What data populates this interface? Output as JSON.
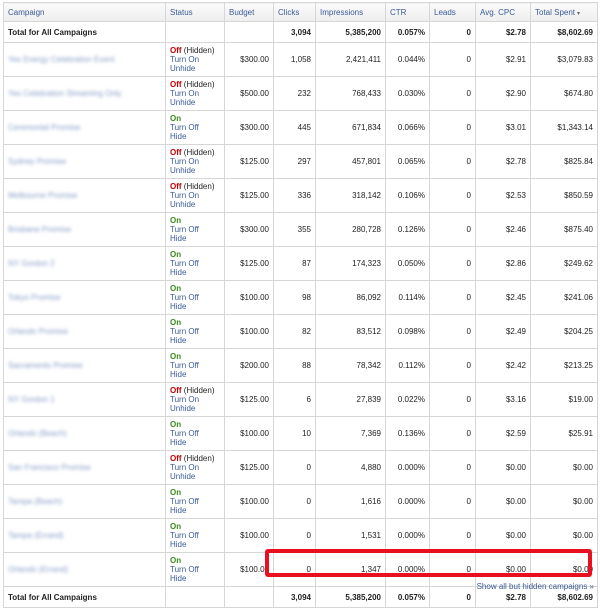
{
  "columns": [
    "Campaign",
    "Status",
    "Budget",
    "Clicks",
    "Impressions",
    "CTR",
    "Leads",
    "Avg. CPC",
    "Total Spent"
  ],
  "sort_indicator": "▾",
  "total": {
    "label": "Total for All Campaigns",
    "clicks": "3,094",
    "impressions": "5,385,200",
    "ctr": "0.057%",
    "leads": "0",
    "avg_cpc": "$2.78",
    "total_spent": "$8,602.69"
  },
  "rows": [
    {
      "name": "Yes Energy Celebration Event",
      "status": "Off",
      "hidden": "(Hidden)",
      "a1": "Turn On",
      "a2": "Unhide",
      "budget": "$300.00",
      "clicks": "1,058",
      "impressions": "2,421,411",
      "ctr": "0.044%",
      "leads": "0",
      "cpc": "$2.91",
      "spent": "$3,079.83"
    },
    {
      "name": "Yes Celebration Streaming Only",
      "status": "Off",
      "hidden": "(Hidden)",
      "a1": "Turn On",
      "a2": "Unhide",
      "budget": "$500.00",
      "clicks": "232",
      "impressions": "768,433",
      "ctr": "0.030%",
      "leads": "0",
      "cpc": "$2.90",
      "spent": "$674.80"
    },
    {
      "name": "Ceremonial Promise",
      "status": "On",
      "hidden": "",
      "a1": "Turn Off",
      "a2": "Hide",
      "budget": "$300.00",
      "clicks": "445",
      "impressions": "671,834",
      "ctr": "0.066%",
      "leads": "0",
      "cpc": "$3.01",
      "spent": "$1,343.14"
    },
    {
      "name": "Sydney Promise",
      "status": "Off",
      "hidden": "(Hidden)",
      "a1": "Turn On",
      "a2": "Unhide",
      "budget": "$125.00",
      "clicks": "297",
      "impressions": "457,801",
      "ctr": "0.065%",
      "leads": "0",
      "cpc": "$2.78",
      "spent": "$825.84"
    },
    {
      "name": "Melbourne Promise",
      "status": "Off",
      "hidden": "(Hidden)",
      "a1": "Turn On",
      "a2": "Unhide",
      "budget": "$125.00",
      "clicks": "336",
      "impressions": "318,142",
      "ctr": "0.106%",
      "leads": "0",
      "cpc": "$2.53",
      "spent": "$850.59"
    },
    {
      "name": "Brisbane Promise",
      "status": "On",
      "hidden": "",
      "a1": "Turn Off",
      "a2": "Hide",
      "budget": "$300.00",
      "clicks": "355",
      "impressions": "280,728",
      "ctr": "0.126%",
      "leads": "0",
      "cpc": "$2.46",
      "spent": "$875.40"
    },
    {
      "name": "NY Gordon 2",
      "status": "On",
      "hidden": "",
      "a1": "Turn Off",
      "a2": "Hide",
      "budget": "$125.00",
      "clicks": "87",
      "impressions": "174,323",
      "ctr": "0.050%",
      "leads": "0",
      "cpc": "$2.86",
      "spent": "$249.62"
    },
    {
      "name": "Tokyo Promise",
      "status": "On",
      "hidden": "",
      "a1": "Turn Off",
      "a2": "Hide",
      "budget": "$100.00",
      "clicks": "98",
      "impressions": "86,092",
      "ctr": "0.114%",
      "leads": "0",
      "cpc": "$2.45",
      "spent": "$241.06"
    },
    {
      "name": "Orlando Promise",
      "status": "On",
      "hidden": "",
      "a1": "Turn Off",
      "a2": "Hide",
      "budget": "$100.00",
      "clicks": "82",
      "impressions": "83,512",
      "ctr": "0.098%",
      "leads": "0",
      "cpc": "$2.49",
      "spent": "$204.25"
    },
    {
      "name": "Sacramento Promise",
      "status": "On",
      "hidden": "",
      "a1": "Turn Off",
      "a2": "Hide",
      "budget": "$200.00",
      "clicks": "88",
      "impressions": "78,342",
      "ctr": "0.112%",
      "leads": "0",
      "cpc": "$2.42",
      "spent": "$213.25"
    },
    {
      "name": "NY Gordon 1",
      "status": "Off",
      "hidden": "(Hidden)",
      "a1": "Turn On",
      "a2": "Unhide",
      "budget": "$125.00",
      "clicks": "6",
      "impressions": "27,839",
      "ctr": "0.022%",
      "leads": "0",
      "cpc": "$3.16",
      "spent": "$19.00"
    },
    {
      "name": "Orlando (Beach)",
      "status": "On",
      "hidden": "",
      "a1": "Turn Off",
      "a2": "Hide",
      "budget": "$100.00",
      "clicks": "10",
      "impressions": "7,369",
      "ctr": "0.136%",
      "leads": "0",
      "cpc": "$2.59",
      "spent": "$25.91"
    },
    {
      "name": "San Francisco Promise",
      "status": "Off",
      "hidden": "(Hidden)",
      "a1": "Turn On",
      "a2": "Unhide",
      "budget": "$125.00",
      "clicks": "0",
      "impressions": "4,880",
      "ctr": "0.000%",
      "leads": "0",
      "cpc": "$0.00",
      "spent": "$0.00"
    },
    {
      "name": "Tampa (Beach)",
      "status": "On",
      "hidden": "",
      "a1": "Turn Off",
      "a2": "Hide",
      "budget": "$100.00",
      "clicks": "0",
      "impressions": "1,616",
      "ctr": "0.000%",
      "leads": "0",
      "cpc": "$0.00",
      "spent": "$0.00"
    },
    {
      "name": "Tampa (Errand)",
      "status": "On",
      "hidden": "",
      "a1": "Turn Off",
      "a2": "Hide",
      "budget": "$100.00",
      "clicks": "0",
      "impressions": "1,531",
      "ctr": "0.000%",
      "leads": "0",
      "cpc": "$0.00",
      "spent": "$0.00"
    },
    {
      "name": "Orlando (Errand)",
      "status": "On",
      "hidden": "",
      "a1": "Turn Off",
      "a2": "Hide",
      "budget": "$100.00",
      "clicks": "0",
      "impressions": "1,347",
      "ctr": "0.000%",
      "leads": "0",
      "cpc": "$0.00",
      "spent": "$0.00"
    }
  ],
  "footer_link": "Show all but hidden campaigns »",
  "colors": {
    "link": "#3b5a9a",
    "on": "#3a8a1a",
    "off": "#c00000",
    "highlight": "#e8101e"
  }
}
